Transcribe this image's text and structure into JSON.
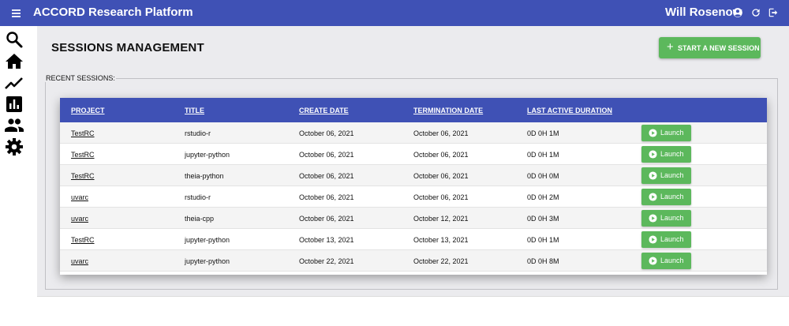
{
  "header": {
    "app_title": "ACCORD Research Platform",
    "user_name": "Will Rosenow",
    "icons": [
      "menu-icon",
      "account-circle-icon",
      "refresh-icon",
      "logout-icon"
    ],
    "color": "#3f51b5"
  },
  "sidebar": {
    "icons": [
      "search-icon",
      "home-icon",
      "trending-icon",
      "bar-chart-icon",
      "people-icon",
      "gear-icon"
    ]
  },
  "main": {
    "title": "SESSIONS MANAGEMENT",
    "start_button": {
      "plus": "+",
      "label": "START A NEW SESSION"
    },
    "recent_label": "RECENT SESSIONS:"
  },
  "table": {
    "columns": [
      "PROJECT",
      "TITLE",
      "CREATE DATE",
      "TERMINATION DATE",
      "LAST ACTIVE DURATION"
    ],
    "launch_label": "Launch",
    "rows": [
      {
        "project": "TestRC",
        "title": "rstudio-r",
        "create": "October 06, 2021",
        "termination": "October 06, 2021",
        "duration": "0D 0H 1M"
      },
      {
        "project": "TestRC",
        "title": "jupyter-python",
        "create": "October 06, 2021",
        "termination": "October 06, 2021",
        "duration": "0D 0H 1M"
      },
      {
        "project": "TestRC",
        "title": "theia-python",
        "create": "October 06, 2021",
        "termination": "October 06, 2021",
        "duration": "0D 0H 0M"
      },
      {
        "project": "uvarc",
        "title": "rstudio-r",
        "create": "October 06, 2021",
        "termination": "October 06, 2021",
        "duration": "0D 0H 2M"
      },
      {
        "project": "uvarc",
        "title": "theia-cpp",
        "create": "October 06, 2021",
        "termination": "October 12, 2021",
        "duration": "0D 0H 3M"
      },
      {
        "project": "TestRC",
        "title": "jupyter-python",
        "create": "October 13, 2021",
        "termination": "October 13, 2021",
        "duration": "0D 0H 1M"
      },
      {
        "project": "uvarc",
        "title": "jupyter-python",
        "create": "October 22, 2021",
        "termination": "October 22, 2021",
        "duration": "0D 0H 8M"
      }
    ]
  },
  "colors": {
    "primary": "#3f51b5",
    "success": "#5cb85c",
    "background": "#ebebee"
  }
}
